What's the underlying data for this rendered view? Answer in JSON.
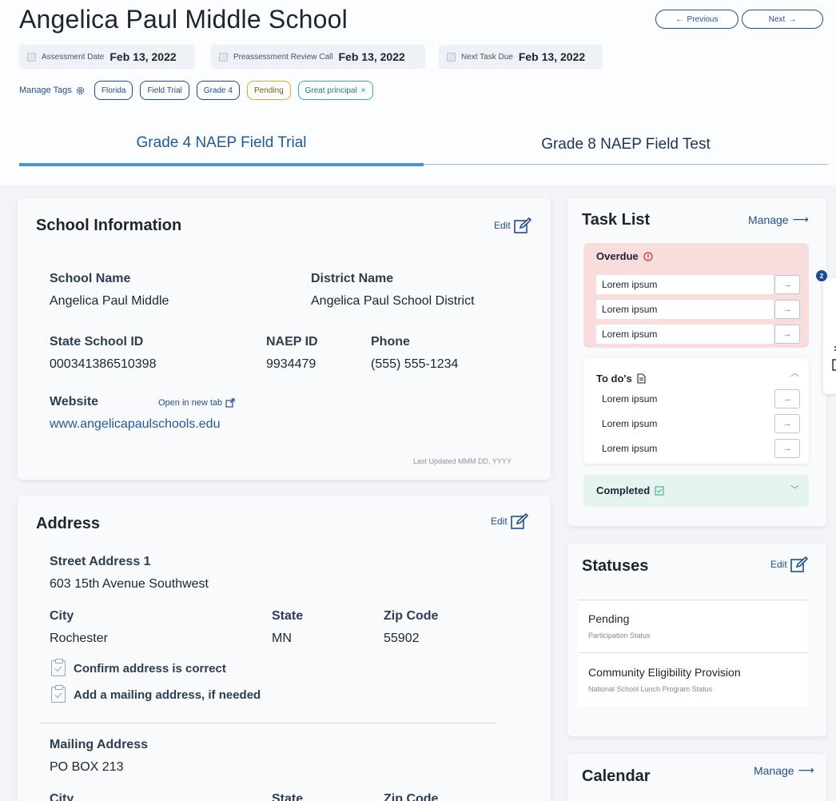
{
  "page": {
    "title": "Angelica Paul Middle School",
    "prev_label": "Previous",
    "next_label": "Next"
  },
  "dates": [
    {
      "label": "Assessment Date",
      "value": "Feb 13, 2022"
    },
    {
      "label": "Preassessment Review Call",
      "value": "Feb 13, 2022"
    },
    {
      "label": "Next Task Due",
      "value": "Feb 13, 2022"
    }
  ],
  "tags": {
    "manage_label": "Manage Tags",
    "items": [
      "Florida",
      "Field Trial",
      "Grade 4",
      "Pending",
      "Great principal"
    ]
  },
  "tabs": [
    "Grade 4 NAEP Field Trial",
    "Grade 8 NAEP Field Test"
  ],
  "school_info": {
    "title": "School Information",
    "edit_label": "Edit",
    "school_name_label": "School Name",
    "school_name": "Angelica Paul Middle",
    "district_name_label": "District Name",
    "district_name": "Angelica Paul School District",
    "state_id_label": "State School ID",
    "state_id": "000341386510398",
    "naep_id_label": "NAEP ID",
    "naep_id": "9934479",
    "phone_label": "Phone",
    "phone": "(555) 555-1234",
    "website_label": "Website",
    "open_tab_label": "Open in new tab",
    "website": "www.angelicapaulschools.edu",
    "last_updated": "Last Updated MMM DD, YYYY"
  },
  "address": {
    "title": "Address",
    "edit_label": "Edit",
    "street_label": "Street Address 1",
    "street": "603 15th Avenue Southwest",
    "city_label": "City",
    "city": "Rochester",
    "state_label": "State",
    "state": "MN",
    "zip_label": "Zip Code",
    "zip": "55902",
    "check1": "Confirm address is correct",
    "check2": "Add a mailing address, if needed",
    "mailing_label": "Mailing Address",
    "mailing": "PO BOX 213",
    "city2_label": "City",
    "state2_label": "State",
    "zip2_label": "Zip Code"
  },
  "task_list": {
    "title": "Task List",
    "manage_label": "Manage",
    "overdue_title": "Overdue",
    "overdue": [
      "Lorem ipsum",
      "Lorem ipsum",
      "Lorem ipsum"
    ],
    "todo_title": "To do's",
    "todo": [
      "Lorem ipsum",
      "Lorem ipsum",
      "Lorem ipsum"
    ],
    "completed_title": "Completed"
  },
  "statuses": {
    "title": "Statuses",
    "edit_label": "Edit",
    "items": [
      {
        "title": "Pending",
        "sub": "Participation Status"
      },
      {
        "title": "Community Eligibility Provision",
        "sub": "National School Lunch Program Status"
      }
    ]
  },
  "calendar": {
    "title": "Calendar",
    "manage_label": "Manage"
  },
  "side_panel": {
    "badge": "2"
  },
  "colors": {
    "accent": "#1f4e8c",
    "tab_active": "#4a95cf",
    "overdue_bg": "#f9dcdc",
    "completed_bg": "#e6f4ef",
    "pending_tag": "#d9a53b",
    "principal_tag": "#3bb08f"
  }
}
